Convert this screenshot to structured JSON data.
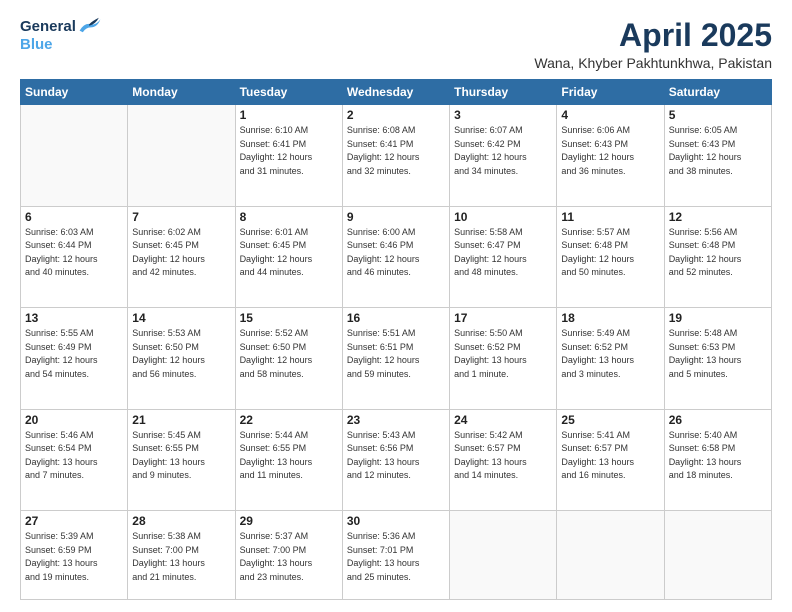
{
  "header": {
    "logo_line1": "General",
    "logo_line2": "Blue",
    "month_title": "April 2025",
    "location": "Wana, Khyber Pakhtunkhwa, Pakistan"
  },
  "weekdays": [
    "Sunday",
    "Monday",
    "Tuesday",
    "Wednesday",
    "Thursday",
    "Friday",
    "Saturday"
  ],
  "weeks": [
    [
      {
        "day": "",
        "info": ""
      },
      {
        "day": "",
        "info": ""
      },
      {
        "day": "1",
        "info": "Sunrise: 6:10 AM\nSunset: 6:41 PM\nDaylight: 12 hours\nand 31 minutes."
      },
      {
        "day": "2",
        "info": "Sunrise: 6:08 AM\nSunset: 6:41 PM\nDaylight: 12 hours\nand 32 minutes."
      },
      {
        "day": "3",
        "info": "Sunrise: 6:07 AM\nSunset: 6:42 PM\nDaylight: 12 hours\nand 34 minutes."
      },
      {
        "day": "4",
        "info": "Sunrise: 6:06 AM\nSunset: 6:43 PM\nDaylight: 12 hours\nand 36 minutes."
      },
      {
        "day": "5",
        "info": "Sunrise: 6:05 AM\nSunset: 6:43 PM\nDaylight: 12 hours\nand 38 minutes."
      }
    ],
    [
      {
        "day": "6",
        "info": "Sunrise: 6:03 AM\nSunset: 6:44 PM\nDaylight: 12 hours\nand 40 minutes."
      },
      {
        "day": "7",
        "info": "Sunrise: 6:02 AM\nSunset: 6:45 PM\nDaylight: 12 hours\nand 42 minutes."
      },
      {
        "day": "8",
        "info": "Sunrise: 6:01 AM\nSunset: 6:45 PM\nDaylight: 12 hours\nand 44 minutes."
      },
      {
        "day": "9",
        "info": "Sunrise: 6:00 AM\nSunset: 6:46 PM\nDaylight: 12 hours\nand 46 minutes."
      },
      {
        "day": "10",
        "info": "Sunrise: 5:58 AM\nSunset: 6:47 PM\nDaylight: 12 hours\nand 48 minutes."
      },
      {
        "day": "11",
        "info": "Sunrise: 5:57 AM\nSunset: 6:48 PM\nDaylight: 12 hours\nand 50 minutes."
      },
      {
        "day": "12",
        "info": "Sunrise: 5:56 AM\nSunset: 6:48 PM\nDaylight: 12 hours\nand 52 minutes."
      }
    ],
    [
      {
        "day": "13",
        "info": "Sunrise: 5:55 AM\nSunset: 6:49 PM\nDaylight: 12 hours\nand 54 minutes."
      },
      {
        "day": "14",
        "info": "Sunrise: 5:53 AM\nSunset: 6:50 PM\nDaylight: 12 hours\nand 56 minutes."
      },
      {
        "day": "15",
        "info": "Sunrise: 5:52 AM\nSunset: 6:50 PM\nDaylight: 12 hours\nand 58 minutes."
      },
      {
        "day": "16",
        "info": "Sunrise: 5:51 AM\nSunset: 6:51 PM\nDaylight: 12 hours\nand 59 minutes."
      },
      {
        "day": "17",
        "info": "Sunrise: 5:50 AM\nSunset: 6:52 PM\nDaylight: 13 hours\nand 1 minute."
      },
      {
        "day": "18",
        "info": "Sunrise: 5:49 AM\nSunset: 6:52 PM\nDaylight: 13 hours\nand 3 minutes."
      },
      {
        "day": "19",
        "info": "Sunrise: 5:48 AM\nSunset: 6:53 PM\nDaylight: 13 hours\nand 5 minutes."
      }
    ],
    [
      {
        "day": "20",
        "info": "Sunrise: 5:46 AM\nSunset: 6:54 PM\nDaylight: 13 hours\nand 7 minutes."
      },
      {
        "day": "21",
        "info": "Sunrise: 5:45 AM\nSunset: 6:55 PM\nDaylight: 13 hours\nand 9 minutes."
      },
      {
        "day": "22",
        "info": "Sunrise: 5:44 AM\nSunset: 6:55 PM\nDaylight: 13 hours\nand 11 minutes."
      },
      {
        "day": "23",
        "info": "Sunrise: 5:43 AM\nSunset: 6:56 PM\nDaylight: 13 hours\nand 12 minutes."
      },
      {
        "day": "24",
        "info": "Sunrise: 5:42 AM\nSunset: 6:57 PM\nDaylight: 13 hours\nand 14 minutes."
      },
      {
        "day": "25",
        "info": "Sunrise: 5:41 AM\nSunset: 6:57 PM\nDaylight: 13 hours\nand 16 minutes."
      },
      {
        "day": "26",
        "info": "Sunrise: 5:40 AM\nSunset: 6:58 PM\nDaylight: 13 hours\nand 18 minutes."
      }
    ],
    [
      {
        "day": "27",
        "info": "Sunrise: 5:39 AM\nSunset: 6:59 PM\nDaylight: 13 hours\nand 19 minutes."
      },
      {
        "day": "28",
        "info": "Sunrise: 5:38 AM\nSunset: 7:00 PM\nDaylight: 13 hours\nand 21 minutes."
      },
      {
        "day": "29",
        "info": "Sunrise: 5:37 AM\nSunset: 7:00 PM\nDaylight: 13 hours\nand 23 minutes."
      },
      {
        "day": "30",
        "info": "Sunrise: 5:36 AM\nSunset: 7:01 PM\nDaylight: 13 hours\nand 25 minutes."
      },
      {
        "day": "",
        "info": ""
      },
      {
        "day": "",
        "info": ""
      },
      {
        "day": "",
        "info": ""
      }
    ]
  ]
}
